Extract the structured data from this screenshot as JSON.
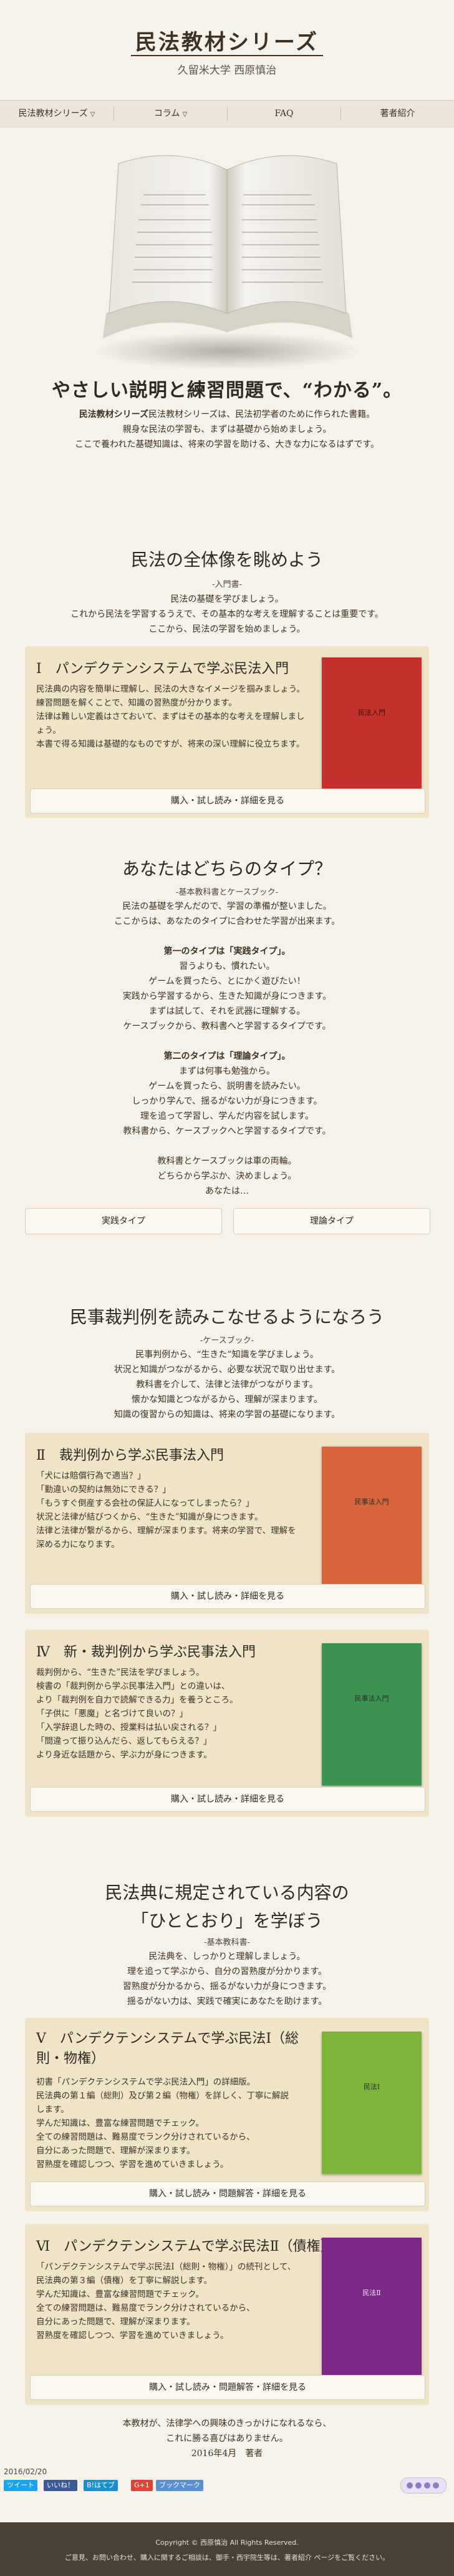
{
  "header": {
    "title": "民法教材シリーズ",
    "subtitle": "久留米大学 西原慎治"
  },
  "nav": [
    {
      "label": "民法教材シリーズ"
    },
    {
      "label": "コラム"
    },
    {
      "label": "FAQ"
    },
    {
      "label": "著者紹介"
    }
  ],
  "hero": {
    "tagline": "やさしい説明と練習問題で、“わかる”。",
    "intro": [
      "民法教材シリーズは、民法初学者のために作られた書籍。",
      "親身な民法の学習も、まずは基礎から始めましょう。",
      "ここで養われた基礎知識は、将来の学習を助ける、大きな力になるはずです。"
    ]
  },
  "section1": {
    "title": "民法の全体像を眺めよう",
    "sub": "-入門書-",
    "lines": [
      "民法の基礎を学びましょう。",
      "これから民法を学習するうえで、その基本的な考えを理解することは重要です。",
      "ここから、民法の学習を始めましょう。"
    ],
    "card": {
      "title": "Ⅰ　パンデクテンシステムで学ぶ民法入門",
      "body": [
        "民法典の内容を簡単に理解し、民法の大きなイメージを掴みましょう。",
        "練習問題を解くことで、知識の習熟度が分かります。",
        "法律は難しい定義はさておいて、まずはその基本的な考えを理解しましょう。",
        "本書で得る知識は基礎的なものですが、将来の深い理解に役立ちます。"
      ],
      "button": "購入・試し読み・詳細を見る",
      "cover_text": "民法入門"
    }
  },
  "section2": {
    "title": "あなたはどちらのタイプ？",
    "sub": "-基本教科書とケースブック-",
    "lines": [
      "民法の基礎を学んだので、学習の準備が整いました。",
      "ここからは、あなたのタイプに合わせた学習が出来ます。",
      "",
      "第一のタイプは「実践タイプ」。",
      "習うよりも、慣れたい。",
      "ゲームを買ったら、とにかく遊びたい！",
      "実践から学習するから、生きた知識が身につきます。",
      "まずは試して、それを武器に理解する。",
      "ケースブックから、教科書へと学習するタイプです。",
      "",
      "第二のタイプは「理論タイプ」。",
      "まずは何事も勉強から。",
      "ゲームを買ったら、説明書を読みたい。",
      "しっかり学んで、揺るがない力が身につきます。",
      "理を追って学習し、学んだ内容を試します。",
      "教科書から、ケースブックへと学習するタイプです。",
      "",
      "教科書とケースブックは車の両輪。",
      "どちらから学ぶか、決めましょう。",
      "あなたは…"
    ],
    "buttons": [
      "実践タイプ",
      "理論タイプ"
    ]
  },
  "section3": {
    "title": "民事裁判例を読みこなせるようになろう",
    "sub": "-ケースブック-",
    "lines": [
      "民事判例から、“生きた”知識を学びましょう。",
      "状況と知識がつながるから、必要な状況で取り出せます。",
      "教科書を介して、法律と法律がつながります。",
      "懐かな知識とつながるから、理解が深まります。",
      "知識の復習からの知識は、将来の学習の基礎になります。"
    ],
    "card2": {
      "title": "Ⅱ　裁判例から学ぶ民事法入門",
      "body": [
        "「犬には賠償行為で適当？」",
        "「勤違いの契約は無効にできる？」",
        "「もうすぐ倒産する会社の保証人になってしまったら？」",
        "状況と法律が結びつくから、“生きた”知識が身につきます。",
        "法律と法律が繋がるから、理解が深まります。将来の学習で、理解を",
        "深める力になります。"
      ],
      "button": "購入・試し読み・詳細を見る",
      "cover_text": "民事法入門"
    },
    "card4": {
      "title": "Ⅳ　新・裁判例から学ぶ民事法入門",
      "body": [
        "裁判例から、“生きた”民法を学びましょう。",
        "検書の「裁判例から学ぶ民事法入門」との違いは、",
        "より「裁判例を自力で読解できる力」を養うところ。",
        "「子供に「悪魔」と名づけて良いの？」",
        "「入学辞退した時の、授業料は払い戻される？」",
        "「間違って振り込んだら、返してもらえる？」",
        "より身近な話題から、学ぶ力が身につきます。"
      ],
      "button": "購入・試し読み・詳細を見る",
      "cover_text": "民事法入門"
    }
  },
  "section4": {
    "title_line1": "民法典に規定されている内容の",
    "title_line2": "「ひととおり」を学ぼう",
    "sub": "-基本教科書-",
    "lines": [
      "民法典を、しっかりと理解しましょう。",
      "理を追って学ぶから、自分の習熟度が分かります。",
      "習熟度が分かるから、揺るがない力が身につきます。",
      "揺るがない力は、実践で確実にあなたを助けます。"
    ],
    "card5": {
      "title": "Ⅴ　パンデクテンシステムで学ぶ民法Ⅰ（総則・物権）",
      "body": [
        "初書「パンデクテンシステムで学ぶ民法入門」の詳細版。",
        "民法典の第１編（総則）及び第２編（物権）を詳しく、丁寧に解説",
        "します。",
        "学んだ知識は、豊富な練習問題でチェック。",
        "全ての練習問題は、難易度でランク分けされているから、",
        "自分にあった問題で、理解が深まります。",
        "習熟度を確認しつつ、学習を進めていきましょう。"
      ],
      "button": "購入・試し読み・問題解答・詳細を見る",
      "cover_text": "民法Ⅰ"
    },
    "card6": {
      "title": "Ⅵ　パンデクテンシステムで学ぶ民法Ⅱ（債権）",
      "body": [
        "「パンデクテンシステムで学ぶ民法Ⅰ（総則・物権）」の続刊として、",
        "民法典の第３編（債権）を丁寧に解説します。",
        "学んだ知識は、豊富な練習問題でチェック。",
        "全ての練習問題は、難易度でランク分けされているから、",
        "自分にあった問題で、理解が深まります。",
        "習熟度を確認しつつ、学習を進めていきましょう。"
      ],
      "button": "購入・試し読み・問題解答・詳細を見る",
      "cover_text": "民法Ⅱ"
    }
  },
  "closing": {
    "lines": [
      "本教材が、法律学への興味のきっかけになれるなら、",
      "これに勝る喜びはありません。",
      "2016年4月　著者"
    ]
  },
  "meta": {
    "date": "2016/02/20",
    "share": [
      "ツイート",
      "いいね！",
      "B!はてブ",
      "G+1",
      "ブックマーク"
    ]
  },
  "footer": {
    "copyright": "Copyright © 西原慎治 All Rights Reserved.",
    "links": "ご意見、お問い合わせ、購入に関するご相談は、御手・西宇院生等は、著者紹介 ページをご覧ください。"
  },
  "colors": {
    "card_bg": "#efe3c8",
    "cover_red": "#c4302b",
    "cover_orange": "#d8643a",
    "cover_green": "#3c9454",
    "cover_lime": "#7db33a",
    "cover_purple": "#7a2a86",
    "footer_bg": "#4a4136"
  }
}
